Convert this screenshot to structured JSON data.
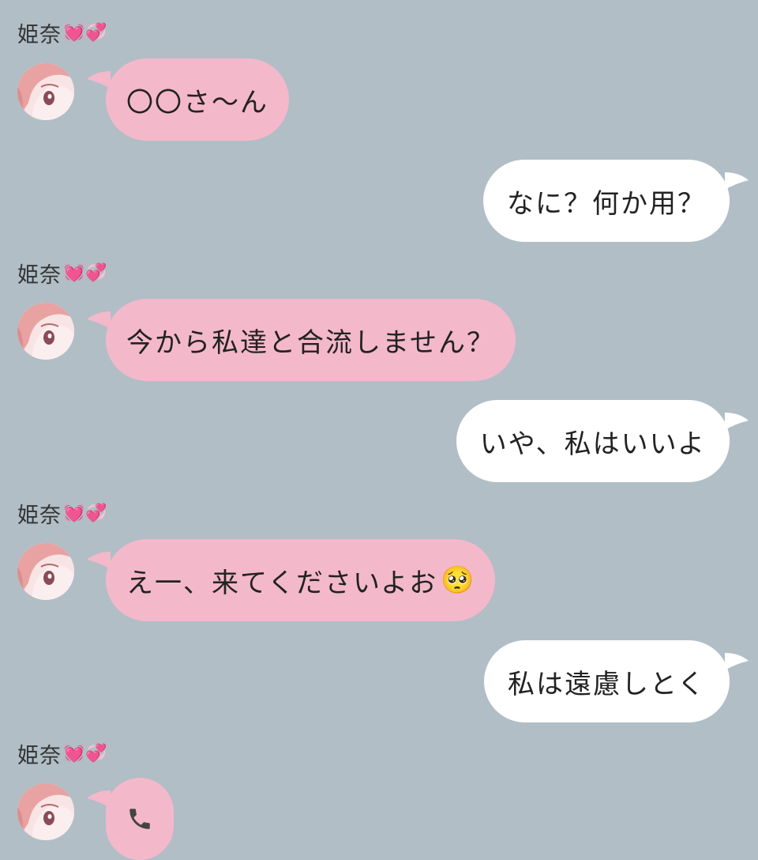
{
  "messages": [
    {
      "type": "incoming",
      "sender": "姫奈",
      "sender_badge": "💓💞",
      "text": "〇〇さ～ん"
    },
    {
      "type": "outgoing",
      "text": "なに？何か用？"
    },
    {
      "type": "incoming",
      "sender": "姫奈",
      "sender_badge": "💓💞",
      "text": "今から私達と合流しません？"
    },
    {
      "type": "outgoing",
      "text": "いや、私はいいよ"
    },
    {
      "type": "incoming",
      "sender": "姫奈",
      "sender_badge": "💓💞",
      "text": "え一、来てくださいよお",
      "emoji": "🥺"
    },
    {
      "type": "outgoing",
      "text": "私は遠慮しとく"
    },
    {
      "type": "incoming",
      "sender": "姫奈",
      "sender_badge": "💓💞",
      "icon": "phone-icon"
    }
  ],
  "colors": {
    "background": "#b1bec6",
    "incoming_bubble": "#f4b8cb",
    "outgoing_bubble": "#ffffff",
    "text": "#222222"
  }
}
